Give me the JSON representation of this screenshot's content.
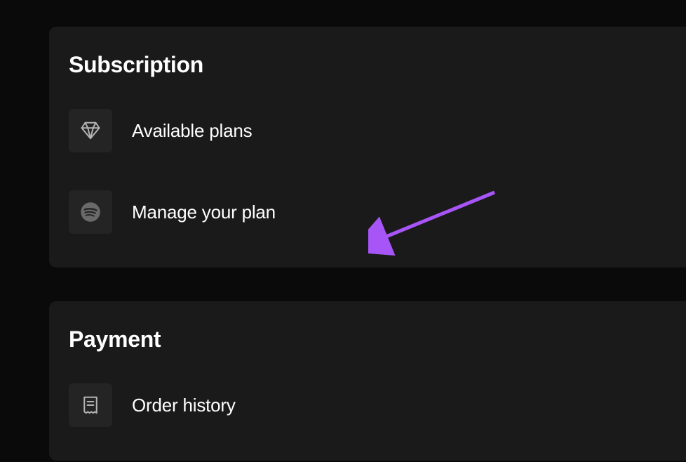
{
  "subscription": {
    "title": "Subscription",
    "items": [
      {
        "label": "Available plans"
      },
      {
        "label": "Manage your plan"
      }
    ]
  },
  "payment": {
    "title": "Payment",
    "items": [
      {
        "label": "Order history"
      }
    ]
  },
  "annotation": {
    "arrow_color": "#a855f7"
  }
}
